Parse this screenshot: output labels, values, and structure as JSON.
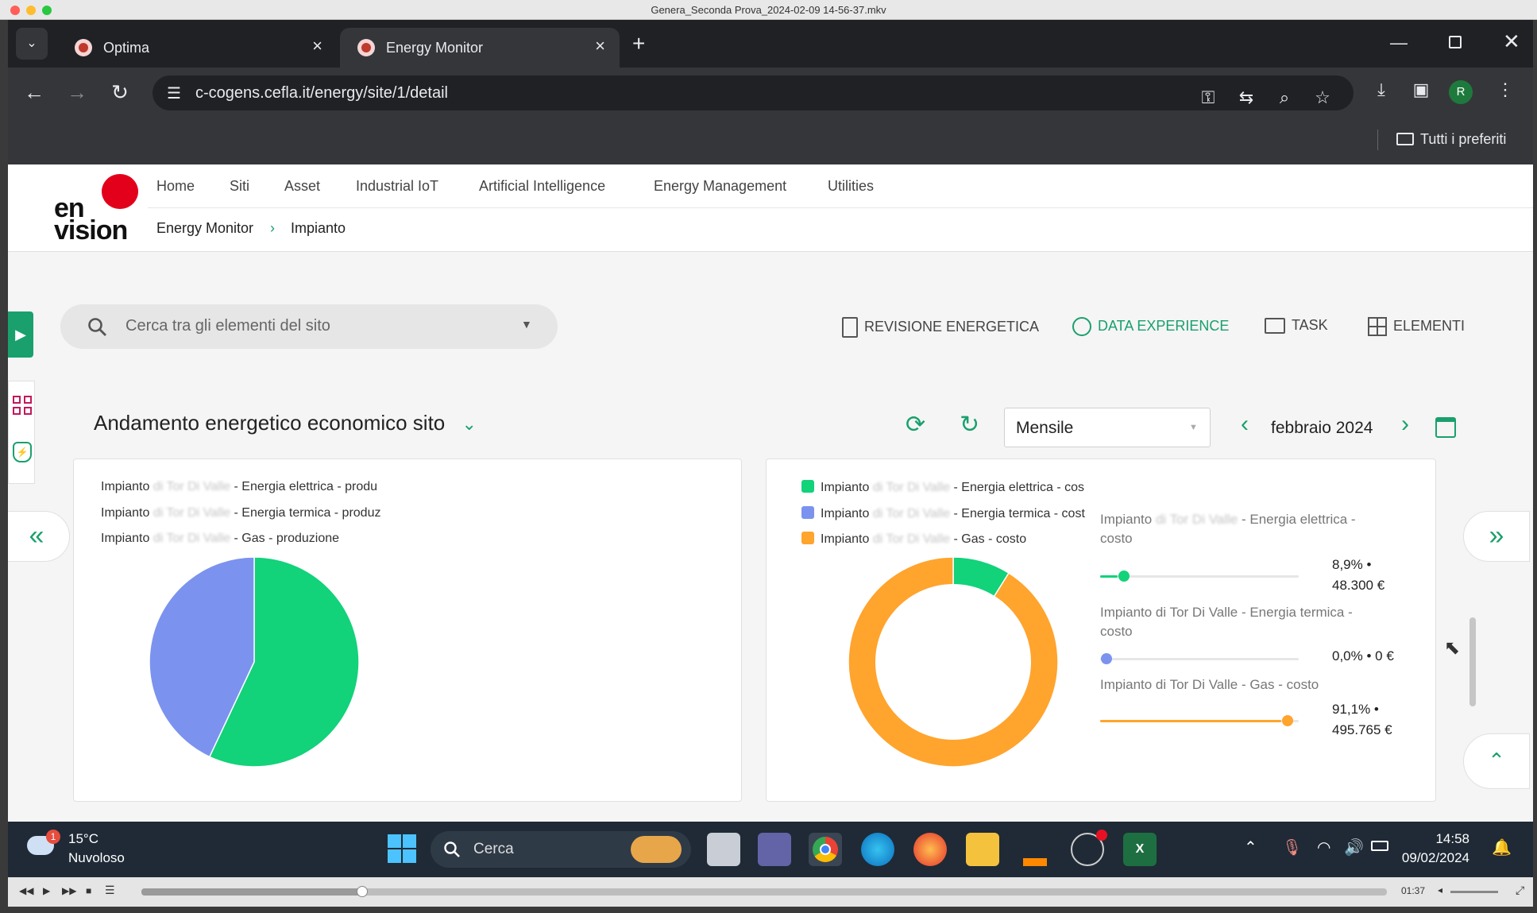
{
  "window": {
    "title": "Genera_Seconda Prova_2024-02-09 14-56-37.mkv"
  },
  "browser": {
    "tabs": [
      {
        "label": "Optima",
        "active": false
      },
      {
        "label": "Energy Monitor",
        "active": true
      }
    ],
    "url": "c-cogens.cefla.it/energy/site/1/detail",
    "profile_initial": "R",
    "bookmarks_label": "Tutti i preferiti"
  },
  "app": {
    "logo": {
      "line1": "en",
      "line2": "vision"
    },
    "menu": [
      "Home",
      "Siti",
      "Asset",
      "Industrial IoT",
      "Artificial Intelligence",
      "Energy Management",
      "Utilities"
    ],
    "breadcrumb": [
      "Energy Monitor",
      "Impianto"
    ],
    "search_placeholder": "Cerca tra gli elementi del sito",
    "actions": [
      {
        "label": "REVISIONE ENERGETICA",
        "active": false
      },
      {
        "label": "DATA EXPERIENCE",
        "active": true
      },
      {
        "label": "TASK",
        "active": false
      },
      {
        "label": "ELEMENTI",
        "active": false
      }
    ],
    "section_title": "Andamento energetico economico sito",
    "period_select": "Mensile",
    "date_label": "febbraio 2024",
    "colors": {
      "accent": "#1aa06d",
      "green": "#12d27a",
      "blue": "#7b93ee",
      "orange": "#ffa42d"
    }
  },
  "left_card": {
    "legend": [
      {
        "prefix": "Impianto",
        "blurred": "di Tor Di Valle",
        "suffix": "- Energia elettrica - produ"
      },
      {
        "prefix": "Impianto",
        "blurred": "di Tor Di Valle",
        "suffix": "- Energia termica - produz"
      },
      {
        "prefix": "Impianto",
        "blurred": "di Tor Di Valle",
        "suffix": "- Gas - produzione"
      }
    ]
  },
  "right_card": {
    "legend": [
      {
        "prefix": "Impianto",
        "blurred": "di Tor Di Valle",
        "suffix": "- Energia elettrica - cos",
        "color": "#12d27a"
      },
      {
        "prefix": "Impianto",
        "blurred": "di Tor Di Valle",
        "suffix": "- Energia termica - cost",
        "color": "#7b93ee"
      },
      {
        "prefix": "Impianto",
        "blurred": "di Tor Di Valle",
        "suffix": "- Gas - costo",
        "color": "#ffa42d"
      }
    ],
    "breakdown": [
      {
        "title_prefix": "Impianto",
        "title_blurred": "di Tor Di Valle",
        "title_suffix": "- Energia elettrica -",
        "title_line2": "costo",
        "value_line1": "8,9% •",
        "value_line2": "48.300 €",
        "fraction": 0.089,
        "color": "#12d27a"
      },
      {
        "title_prefix": "Impianto di Tor Di Valle - Energia termica -",
        "title_blurred": "",
        "title_suffix": "",
        "title_line2": "costo",
        "value_line1": "0,0% • 0 €",
        "value_line2": "",
        "fraction": 0.0,
        "color": "#7b93ee"
      },
      {
        "title_prefix": "Impianto di Tor Di Valle - Gas - costo",
        "title_blurred": "",
        "title_suffix": "",
        "title_line2": "",
        "value_line1": "91,1% •",
        "value_line2": "495.765 €",
        "fraction": 0.911,
        "color": "#ffa42d"
      }
    ]
  },
  "chart_data": [
    {
      "type": "pie",
      "labels": [
        "Energia elettrica - produzione",
        "Energia termica - produzione"
      ],
      "values": [
        57,
        43
      ],
      "colors": [
        "#12d27a",
        "#7b93ee"
      ]
    },
    {
      "type": "pie",
      "donut": true,
      "labels": [
        "Energia elettrica - costo",
        "Energia termica - costo",
        "Gas - costo"
      ],
      "values": [
        8.9,
        0.0,
        91.1
      ],
      "colors": [
        "#12d27a",
        "#7b93ee",
        "#ffa42d"
      ]
    }
  ],
  "taskbar": {
    "weather_temp": "15°C",
    "weather_desc": "Nuvoloso",
    "weather_badge": "1",
    "search_label": "Cerca",
    "time": "14:58",
    "date": "09/02/2024"
  },
  "player": {
    "time": "01:37",
    "progress": 0.177
  }
}
